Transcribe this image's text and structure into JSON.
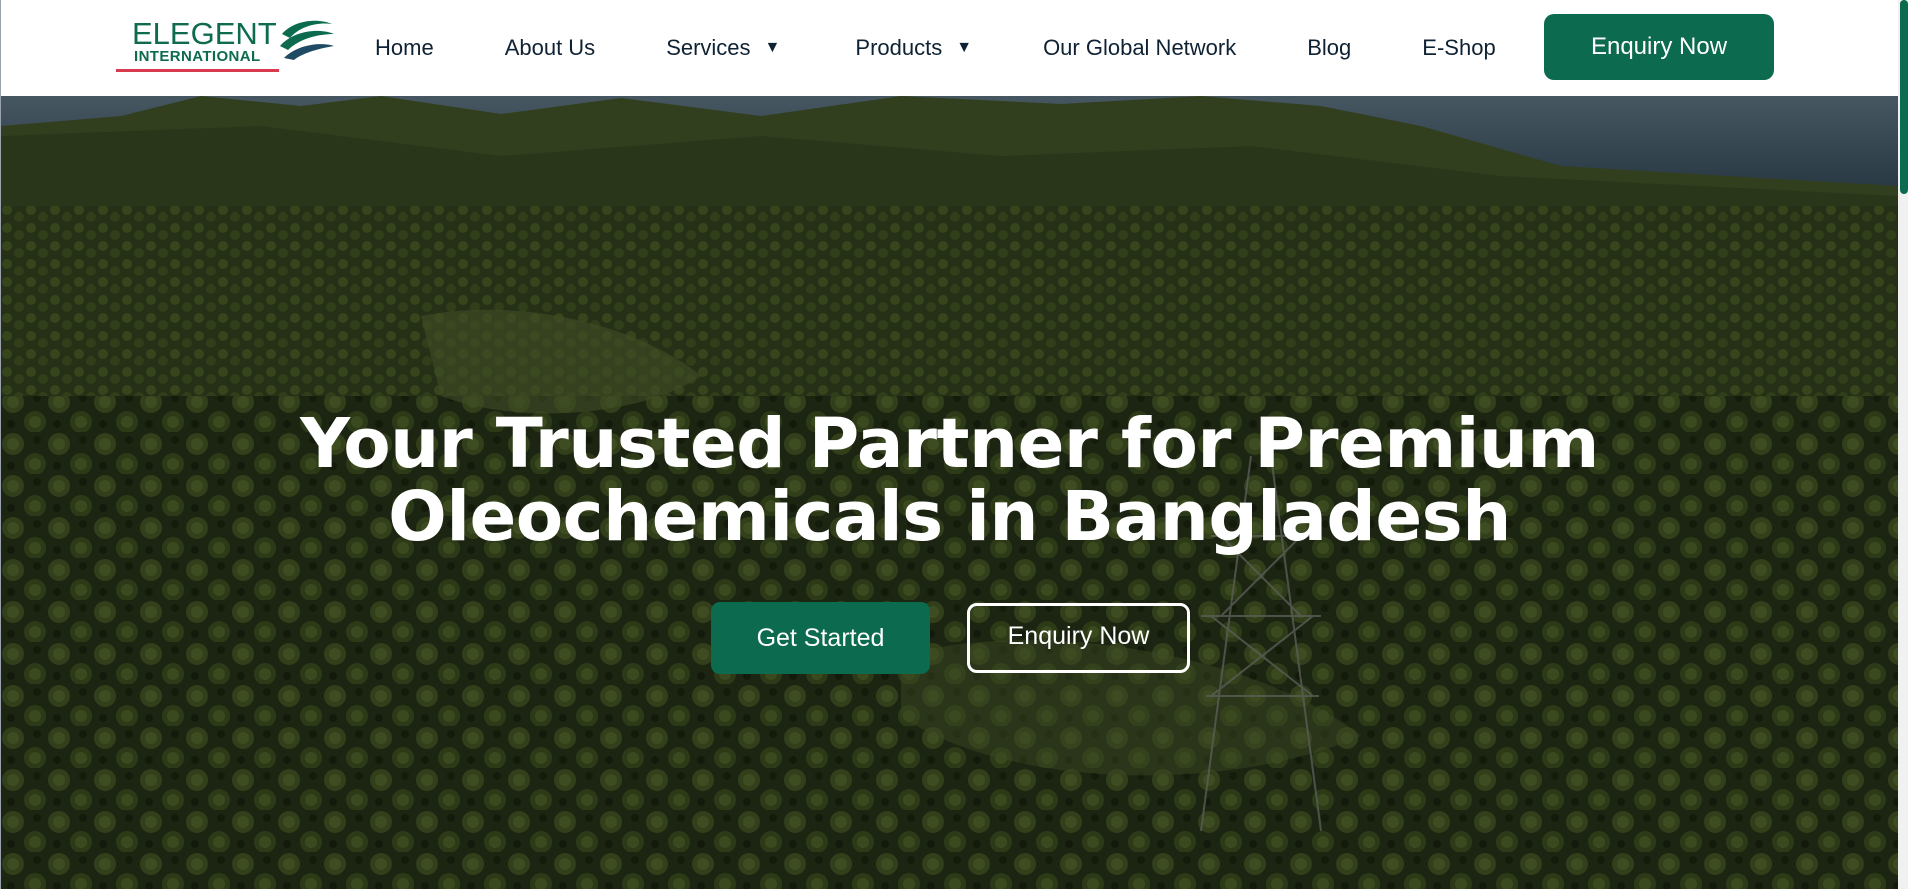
{
  "brand": {
    "name_line1": "ELEGENT",
    "name_line2": "INTERNATIONAL",
    "primary_color": "#0c6a4e",
    "accent_color": "#d93a4e"
  },
  "nav": {
    "items": [
      {
        "label": "Home",
        "has_dropdown": false
      },
      {
        "label": "About Us",
        "has_dropdown": false
      },
      {
        "label": "Services",
        "has_dropdown": true
      },
      {
        "label": "Products",
        "has_dropdown": true
      },
      {
        "label": "Our Global Network",
        "has_dropdown": false
      },
      {
        "label": "Blog",
        "has_dropdown": false
      },
      {
        "label": "E-Shop",
        "has_dropdown": false
      }
    ],
    "caret_glyph": "▼",
    "cta_label": "Enquiry Now"
  },
  "hero": {
    "title_line1": "Your Trusted Partner for Premium",
    "title_line2": "Oleochemicals in Bangladesh",
    "primary_button": "Get Started",
    "secondary_button": "Enquiry Now",
    "background": "aerial-palm-plantation-image"
  }
}
